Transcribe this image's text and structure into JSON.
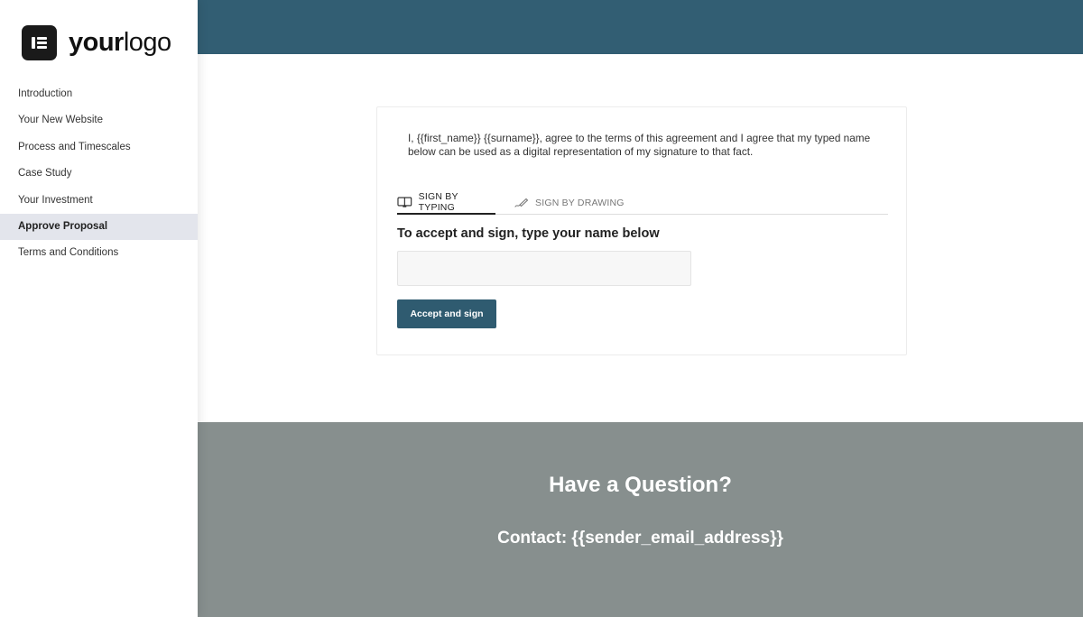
{
  "colors": {
    "header": "#325e73",
    "button": "#2f5b70",
    "footer": "#878f8e",
    "active_nav": "#e3e5ec"
  },
  "logo": {
    "icon": "logo-mark-icon",
    "text_bold": "your",
    "text_regular": "logo"
  },
  "sidebar": {
    "items": [
      {
        "label": "Introduction"
      },
      {
        "label": "Your New Website"
      },
      {
        "label": "Process and Timescales"
      },
      {
        "label": "Case Study"
      },
      {
        "label": "Your Investment"
      },
      {
        "label": "Approve Proposal",
        "active": true
      },
      {
        "label": "Terms and Conditions"
      }
    ]
  },
  "signature": {
    "agreement": "I, {{first_name}} {{surname}}, agree to the terms of this agreement and I agree that my typed name below can be used as a digital representation of my signature to that fact.",
    "tabs": [
      {
        "label": "SIGN BY TYPING",
        "icon": "keyboard-icon",
        "active": true
      },
      {
        "label": "SIGN BY DRAWING",
        "icon": "pen-icon",
        "active": false
      }
    ],
    "heading": "To accept and sign, type your name below",
    "input_value": "",
    "button_label": "Accept and sign"
  },
  "footer": {
    "title": "Have a Question?",
    "contact": "Contact: {{sender_email_address}}"
  }
}
